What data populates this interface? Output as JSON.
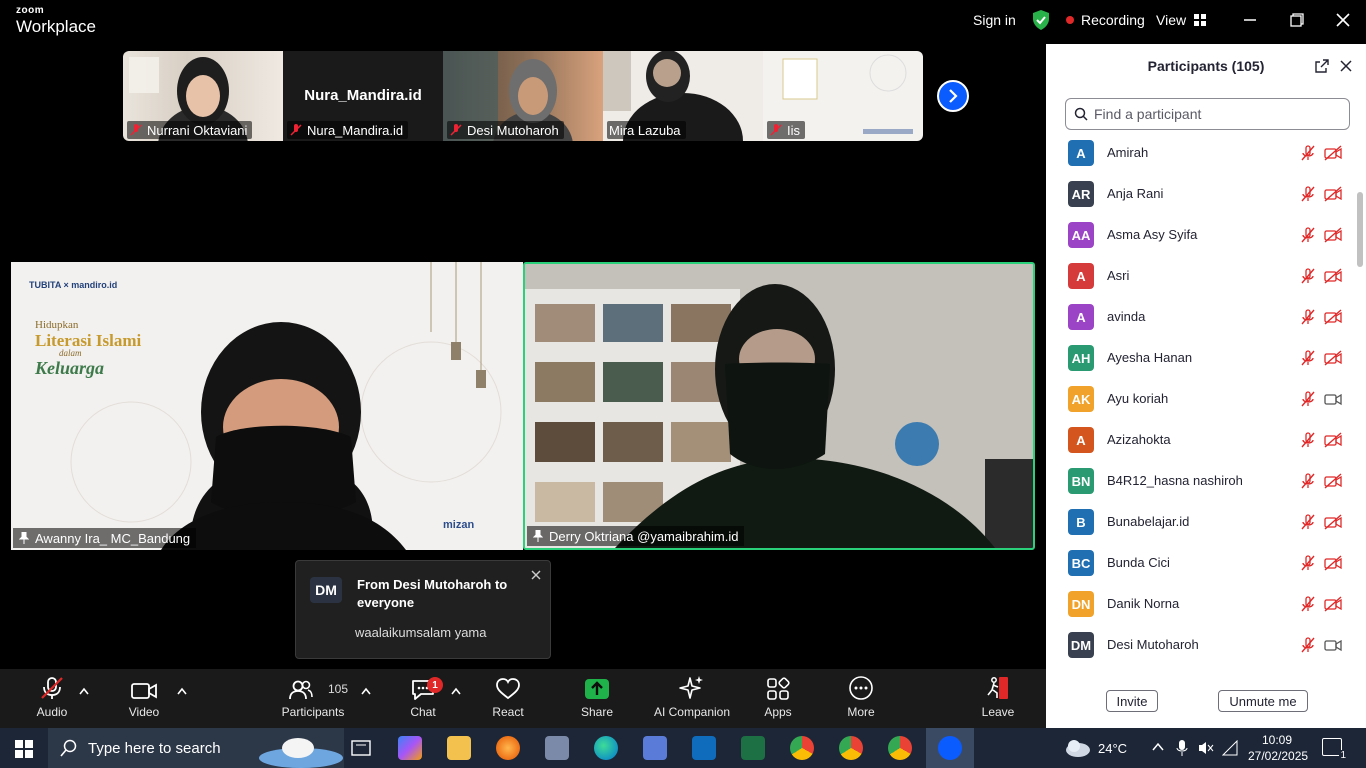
{
  "titlebar": {
    "brand_small": "zoom",
    "brand_big": "Workplace",
    "sign_in": "Sign in",
    "recording": "Recording",
    "view": "View"
  },
  "thumbnails": [
    {
      "name": "Nurrani Oktaviani"
    },
    {
      "name": "Nura_Mandira.id",
      "display_name": "Nura_Mandira.id"
    },
    {
      "name": "Desi Mutoharoh"
    },
    {
      "name": "Mira Lazuba"
    },
    {
      "name": "Iis"
    }
  ],
  "tiles": {
    "left": {
      "name": "Awanny Ira_ MC_Bandung",
      "slide_brand1": "TUBITA",
      "slide_brand2": "mandiro.id",
      "slide_title1": "Hidupkan",
      "slide_title2": "Literasi Islami",
      "slide_title3": "dalam",
      "slide_title4": "Keluarga",
      "slide_sponsor": "mizan"
    },
    "right": {
      "name": "Derry Oktriana @yamaibrahim.id"
    }
  },
  "chat_popup": {
    "initials": "DM",
    "from": "From Desi Mutoharoh to everyone",
    "message": "waalaikumsalam yama"
  },
  "toolbar": {
    "audio": "Audio",
    "video": "Video",
    "participants": "Participants",
    "participants_count": "105",
    "chat": "Chat",
    "chat_badge": "1",
    "react": "React",
    "share": "Share",
    "ai": "AI Companion",
    "apps": "Apps",
    "more": "More",
    "leave": "Leave"
  },
  "panel": {
    "title": "Participants (105)",
    "search_placeholder": "Find a participant",
    "invite": "Invite",
    "unmute_me": "Unmute me",
    "participants": [
      {
        "initials": "A",
        "name": "Amirah",
        "color": "#1f6fb2",
        "video": "off"
      },
      {
        "initials": "AR",
        "name": "Anja Rani",
        "color": "#394150",
        "video": "off"
      },
      {
        "initials": "AA",
        "name": "Asma Asy Syifa",
        "color": "#9b44c6",
        "video": "off"
      },
      {
        "initials": "A",
        "name": "Asri",
        "color": "#d63b3b",
        "video": "off"
      },
      {
        "initials": "A",
        "name": "avinda",
        "color": "#9b44c6",
        "video": "off"
      },
      {
        "initials": "AH",
        "name": "Ayesha Hanan",
        "color": "#2a9a72",
        "video": "off"
      },
      {
        "initials": "AK",
        "name": "Ayu koriah",
        "color": "#f0a22a",
        "video": "on"
      },
      {
        "initials": "A",
        "name": "Azizahokta",
        "color": "#d4561e",
        "video": "off"
      },
      {
        "initials": "BN",
        "name": "B4R12_hasna nashiroh",
        "color": "#2a9a72",
        "video": "off"
      },
      {
        "initials": "B",
        "name": "Bunabelajar.id",
        "color": "#1f6fb2",
        "video": "off"
      },
      {
        "initials": "BC",
        "name": "Bunda Cici",
        "color": "#1f6fb2",
        "video": "off"
      },
      {
        "initials": "DN",
        "name": "Danik Norna",
        "color": "#f0a22a",
        "video": "off"
      },
      {
        "initials": "DM",
        "name": "Desi Mutoharoh",
        "color": "#394150",
        "video": "on"
      }
    ]
  },
  "taskbar": {
    "search": "Type here to search",
    "temperature": "24°C",
    "time": "10:09",
    "date": "27/02/2025",
    "notif_count": "1"
  }
}
